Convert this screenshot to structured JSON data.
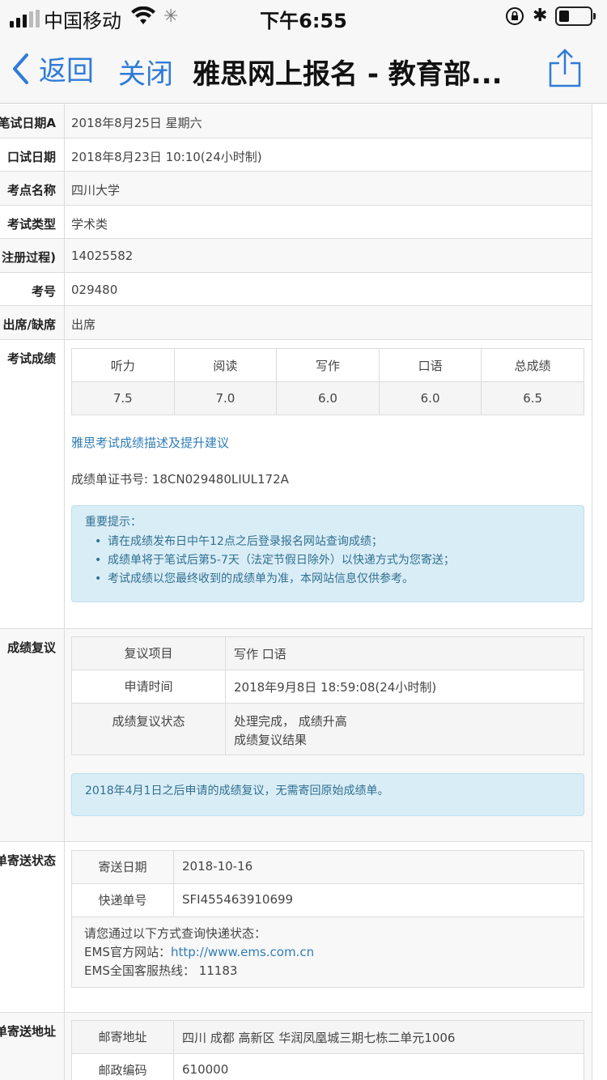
{
  "status_bar": {
    "carrier": "中国移动",
    "time": "下午6:55"
  },
  "nav": {
    "back_label": "返回",
    "close_label": "关闭",
    "title": "雅思网上报名 - 教育部..."
  },
  "info_rows": [
    {
      "label": "笔试日期A",
      "value": "2018年8月25日 星期六"
    },
    {
      "label": "口试日期",
      "value": "2018年8月23日 10:10(24小时制)"
    },
    {
      "label": "考点名称",
      "value": "四川大学"
    },
    {
      "label": "考试类型",
      "value": "学术类"
    },
    {
      "label": "注册过程)",
      "value": "14025582"
    },
    {
      "label": "考号",
      "value": "029480"
    },
    {
      "label": "出席/缺席",
      "value": "出席"
    }
  ],
  "scores_section": {
    "label": "考试成绩",
    "headers": [
      "听力",
      "阅读",
      "写作",
      "口语",
      "总成绩"
    ],
    "values": [
      "7.5",
      "7.0",
      "6.0",
      "6.0",
      "6.5"
    ],
    "advice_link": "雅思考试成绩描述及提升建议",
    "certificate": "成绩单证书号: 18CN029480LIUL172A",
    "notice": {
      "title": "重要提示：",
      "items": [
        "请在成绩发布日中午12点之后登录报名网站查询成绩；",
        "成绩单将于笔试后第5-7天（法定节假日除外）以快递方式为您寄送；",
        "考试成绩以您最终收到的成绩单为准，本网站信息仅供参考。"
      ]
    }
  },
  "review_section": {
    "label": "成绩复议",
    "rows": [
      {
        "key": "复议项目",
        "value": "写作 口语"
      },
      {
        "key": "申请时间",
        "value": "2018年9月8日 18:59:08(24小时制)"
      },
      {
        "key": "成绩复议状态",
        "value": "处理完成， 成绩升高",
        "link": "成绩复议结果"
      }
    ],
    "notice": "2018年4月1日之后申请的成绩复议，无需寄回原始成绩单。"
  },
  "shipping_status_section": {
    "label": "单寄送状态",
    "rows": [
      {
        "key": "寄送日期",
        "value": "2018-10-16"
      },
      {
        "key": "快递单号",
        "value": "SFI455463910699"
      }
    ],
    "query_intro": "请您通过以下方式查询快递状态：",
    "ems_site_label": "EMS官方网站：",
    "ems_site_url": "http://www.ems.com.cn",
    "ems_hotline": "EMS全国客服热线： 11183"
  },
  "shipping_address_section": {
    "label": "单寄送地址",
    "rows": [
      {
        "key": "邮寄地址",
        "value": "四川 成都 高新区 华润凤凰城三期七栋二单元1006"
      },
      {
        "key": "邮政编码",
        "value": "610000"
      }
    ]
  },
  "colors": {
    "ios_blue": "#2f7bd8",
    "link_blue": "#2f7db7",
    "notice_bg": "#d9edf7",
    "notice_text": "#31708f"
  }
}
